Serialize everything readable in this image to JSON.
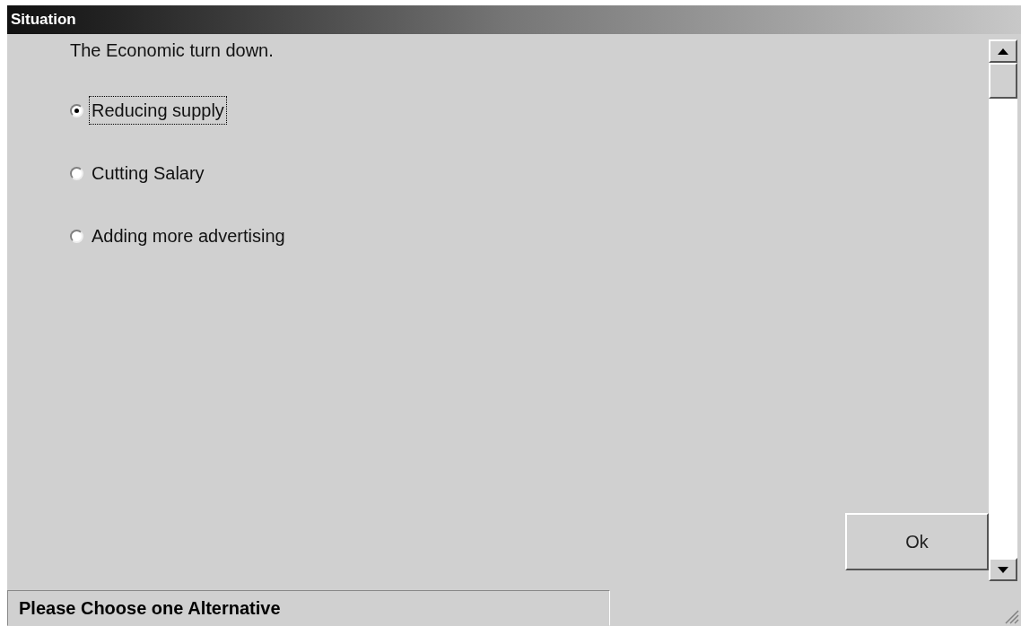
{
  "window": {
    "title": "Situation"
  },
  "question": "The Economic turn down.",
  "options": [
    {
      "label": "Reducing supply",
      "selected": true
    },
    {
      "label": "Cutting Salary",
      "selected": false
    },
    {
      "label": "Adding more advertising",
      "selected": false
    }
  ],
  "button": "Ok",
  "status_bar": "Please Choose one Alternative"
}
